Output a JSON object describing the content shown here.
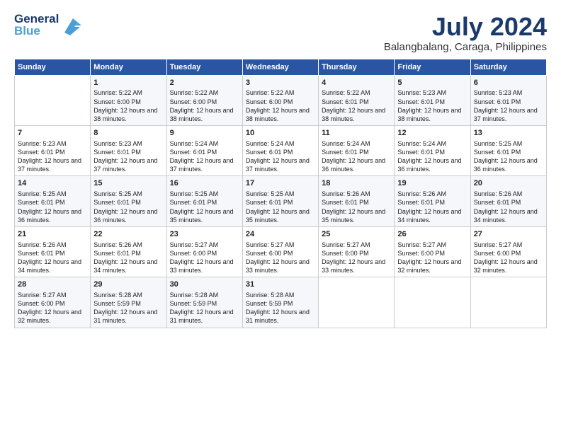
{
  "logo": {
    "line1": "General",
    "line2": "Blue"
  },
  "title": "July 2024",
  "subtitle": "Balangbalang, Caraga, Philippines",
  "days_of_week": [
    "Sunday",
    "Monday",
    "Tuesday",
    "Wednesday",
    "Thursday",
    "Friday",
    "Saturday"
  ],
  "weeks": [
    [
      {
        "day": "",
        "sunrise": "",
        "sunset": "",
        "daylight": ""
      },
      {
        "day": "1",
        "sunrise": "Sunrise: 5:22 AM",
        "sunset": "Sunset: 6:00 PM",
        "daylight": "Daylight: 12 hours and 38 minutes."
      },
      {
        "day": "2",
        "sunrise": "Sunrise: 5:22 AM",
        "sunset": "Sunset: 6:00 PM",
        "daylight": "Daylight: 12 hours and 38 minutes."
      },
      {
        "day": "3",
        "sunrise": "Sunrise: 5:22 AM",
        "sunset": "Sunset: 6:00 PM",
        "daylight": "Daylight: 12 hours and 38 minutes."
      },
      {
        "day": "4",
        "sunrise": "Sunrise: 5:22 AM",
        "sunset": "Sunset: 6:01 PM",
        "daylight": "Daylight: 12 hours and 38 minutes."
      },
      {
        "day": "5",
        "sunrise": "Sunrise: 5:23 AM",
        "sunset": "Sunset: 6:01 PM",
        "daylight": "Daylight: 12 hours and 38 minutes."
      },
      {
        "day": "6",
        "sunrise": "Sunrise: 5:23 AM",
        "sunset": "Sunset: 6:01 PM",
        "daylight": "Daylight: 12 hours and 37 minutes."
      }
    ],
    [
      {
        "day": "7",
        "sunrise": "Sunrise: 5:23 AM",
        "sunset": "Sunset: 6:01 PM",
        "daylight": "Daylight: 12 hours and 37 minutes."
      },
      {
        "day": "8",
        "sunrise": "Sunrise: 5:23 AM",
        "sunset": "Sunset: 6:01 PM",
        "daylight": "Daylight: 12 hours and 37 minutes."
      },
      {
        "day": "9",
        "sunrise": "Sunrise: 5:24 AM",
        "sunset": "Sunset: 6:01 PM",
        "daylight": "Daylight: 12 hours and 37 minutes."
      },
      {
        "day": "10",
        "sunrise": "Sunrise: 5:24 AM",
        "sunset": "Sunset: 6:01 PM",
        "daylight": "Daylight: 12 hours and 37 minutes."
      },
      {
        "day": "11",
        "sunrise": "Sunrise: 5:24 AM",
        "sunset": "Sunset: 6:01 PM",
        "daylight": "Daylight: 12 hours and 36 minutes."
      },
      {
        "day": "12",
        "sunrise": "Sunrise: 5:24 AM",
        "sunset": "Sunset: 6:01 PM",
        "daylight": "Daylight: 12 hours and 36 minutes."
      },
      {
        "day": "13",
        "sunrise": "Sunrise: 5:25 AM",
        "sunset": "Sunset: 6:01 PM",
        "daylight": "Daylight: 12 hours and 36 minutes."
      }
    ],
    [
      {
        "day": "14",
        "sunrise": "Sunrise: 5:25 AM",
        "sunset": "Sunset: 6:01 PM",
        "daylight": "Daylight: 12 hours and 36 minutes."
      },
      {
        "day": "15",
        "sunrise": "Sunrise: 5:25 AM",
        "sunset": "Sunset: 6:01 PM",
        "daylight": "Daylight: 12 hours and 36 minutes."
      },
      {
        "day": "16",
        "sunrise": "Sunrise: 5:25 AM",
        "sunset": "Sunset: 6:01 PM",
        "daylight": "Daylight: 12 hours and 35 minutes."
      },
      {
        "day": "17",
        "sunrise": "Sunrise: 5:25 AM",
        "sunset": "Sunset: 6:01 PM",
        "daylight": "Daylight: 12 hours and 35 minutes."
      },
      {
        "day": "18",
        "sunrise": "Sunrise: 5:26 AM",
        "sunset": "Sunset: 6:01 PM",
        "daylight": "Daylight: 12 hours and 35 minutes."
      },
      {
        "day": "19",
        "sunrise": "Sunrise: 5:26 AM",
        "sunset": "Sunset: 6:01 PM",
        "daylight": "Daylight: 12 hours and 34 minutes."
      },
      {
        "day": "20",
        "sunrise": "Sunrise: 5:26 AM",
        "sunset": "Sunset: 6:01 PM",
        "daylight": "Daylight: 12 hours and 34 minutes."
      }
    ],
    [
      {
        "day": "21",
        "sunrise": "Sunrise: 5:26 AM",
        "sunset": "Sunset: 6:01 PM",
        "daylight": "Daylight: 12 hours and 34 minutes."
      },
      {
        "day": "22",
        "sunrise": "Sunrise: 5:26 AM",
        "sunset": "Sunset: 6:01 PM",
        "daylight": "Daylight: 12 hours and 34 minutes."
      },
      {
        "day": "23",
        "sunrise": "Sunrise: 5:27 AM",
        "sunset": "Sunset: 6:00 PM",
        "daylight": "Daylight: 12 hours and 33 minutes."
      },
      {
        "day": "24",
        "sunrise": "Sunrise: 5:27 AM",
        "sunset": "Sunset: 6:00 PM",
        "daylight": "Daylight: 12 hours and 33 minutes."
      },
      {
        "day": "25",
        "sunrise": "Sunrise: 5:27 AM",
        "sunset": "Sunset: 6:00 PM",
        "daylight": "Daylight: 12 hours and 33 minutes."
      },
      {
        "day": "26",
        "sunrise": "Sunrise: 5:27 AM",
        "sunset": "Sunset: 6:00 PM",
        "daylight": "Daylight: 12 hours and 32 minutes."
      },
      {
        "day": "27",
        "sunrise": "Sunrise: 5:27 AM",
        "sunset": "Sunset: 6:00 PM",
        "daylight": "Daylight: 12 hours and 32 minutes."
      }
    ],
    [
      {
        "day": "28",
        "sunrise": "Sunrise: 5:27 AM",
        "sunset": "Sunset: 6:00 PM",
        "daylight": "Daylight: 12 hours and 32 minutes."
      },
      {
        "day": "29",
        "sunrise": "Sunrise: 5:28 AM",
        "sunset": "Sunset: 5:59 PM",
        "daylight": "Daylight: 12 hours and 31 minutes."
      },
      {
        "day": "30",
        "sunrise": "Sunrise: 5:28 AM",
        "sunset": "Sunset: 5:59 PM",
        "daylight": "Daylight: 12 hours and 31 minutes."
      },
      {
        "day": "31",
        "sunrise": "Sunrise: 5:28 AM",
        "sunset": "Sunset: 5:59 PM",
        "daylight": "Daylight: 12 hours and 31 minutes."
      },
      {
        "day": "",
        "sunrise": "",
        "sunset": "",
        "daylight": ""
      },
      {
        "day": "",
        "sunrise": "",
        "sunset": "",
        "daylight": ""
      },
      {
        "day": "",
        "sunrise": "",
        "sunset": "",
        "daylight": ""
      }
    ]
  ]
}
